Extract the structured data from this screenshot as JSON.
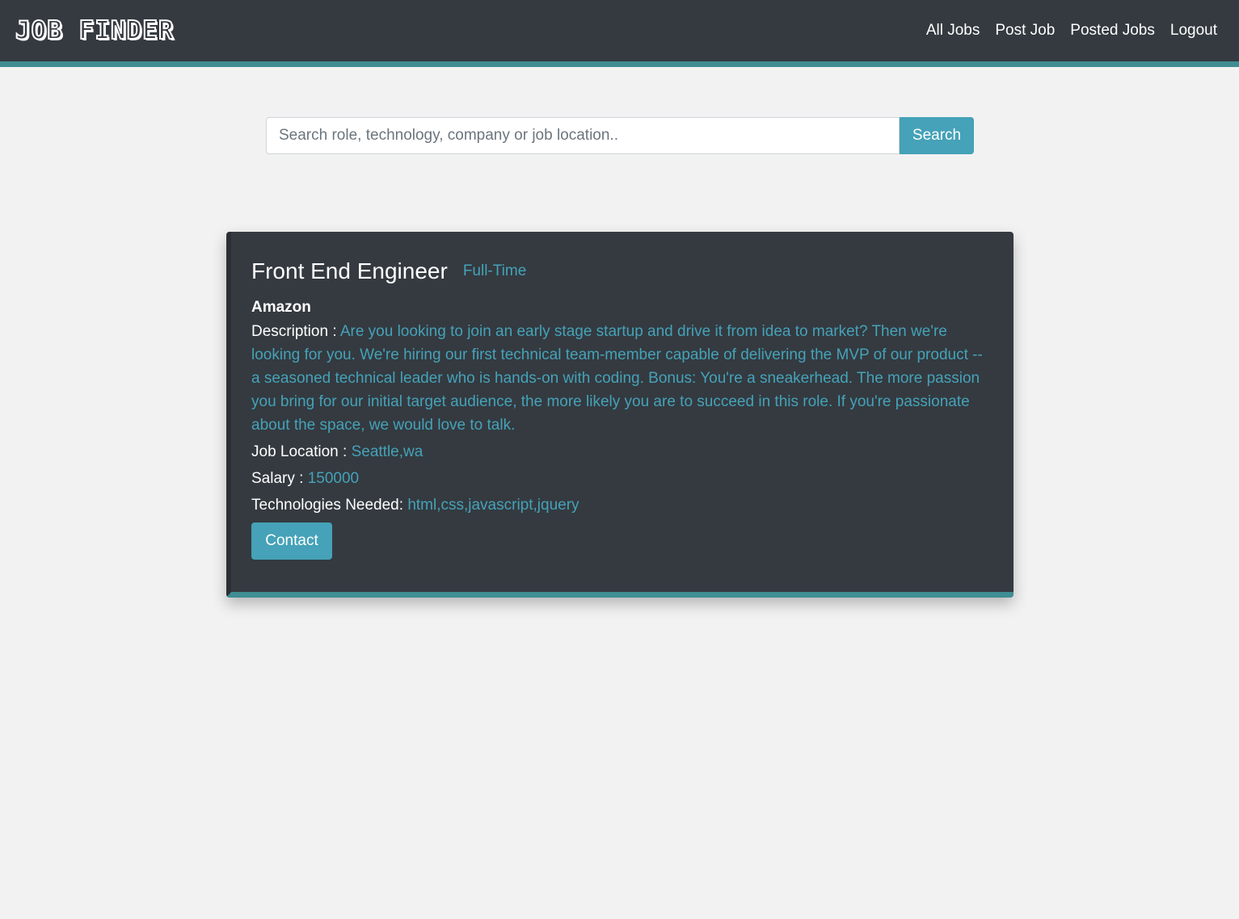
{
  "header": {
    "brand": "JOB FINDER",
    "nav": [
      "All Jobs",
      "Post Job",
      "Posted Jobs",
      "Logout"
    ]
  },
  "search": {
    "placeholder": "Search role, technology, company or job location..",
    "button_label": "Search"
  },
  "job": {
    "title": "Front End Engineer",
    "type": "Full-Time",
    "company": "Amazon",
    "description_label": "Description : ",
    "description": "Are you looking to join an early stage startup and drive it from idea to market? Then we're looking for you. We're hiring our first technical team-member capable of delivering the MVP of our product -- a seasoned technical leader who is hands-on with coding. Bonus: You're a sneakerhead. The more passion you bring for our initial target audience, the more likely you are to succeed in this role. If you're passionate about the space, we would love to talk.",
    "location_label": "Job Location : ",
    "location": "Seattle,wa",
    "salary_label": "Salary : ",
    "salary": "150000",
    "tech_label": "Technologies Needed: ",
    "tech": "html,css,javascript,jquery",
    "contact_label": "Contact"
  },
  "colors": {
    "navbar": "#343a40",
    "accent": "#45a2b8",
    "accent_border": "#3e8e93",
    "background": "#f2f2f2"
  }
}
